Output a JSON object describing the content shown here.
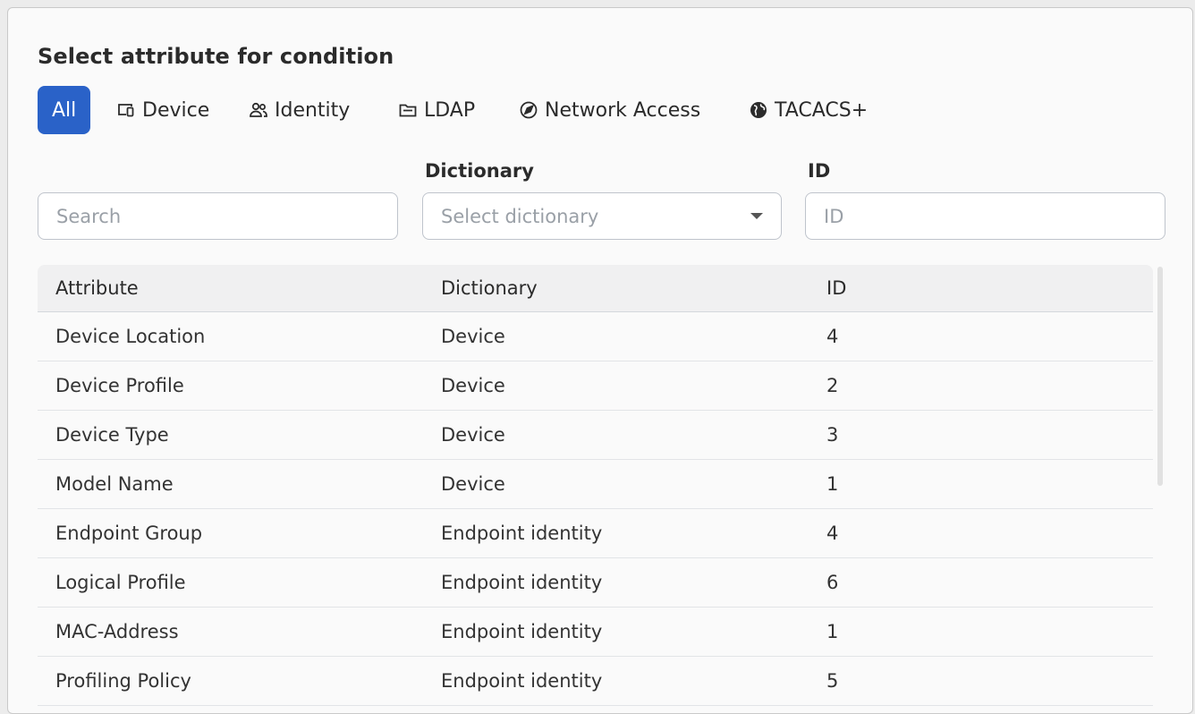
{
  "header": {
    "title": "Select attribute for condition"
  },
  "tabs": [
    {
      "label": "All",
      "icon": "",
      "active": true
    },
    {
      "label": "Device",
      "icon": "device-icon",
      "active": false
    },
    {
      "label": "Identity",
      "icon": "identity-icon",
      "active": false
    },
    {
      "label": "LDAP",
      "icon": "folder-icon",
      "active": false
    },
    {
      "label": "Network Access",
      "icon": "network-access-icon",
      "active": false
    },
    {
      "label": "TACACS+",
      "icon": "globe-icon",
      "active": false
    }
  ],
  "filters": {
    "search": {
      "label": "",
      "placeholder": "Search"
    },
    "dictionary": {
      "label": "Dictionary",
      "placeholder": "Select dictionary"
    },
    "id": {
      "label": "ID",
      "placeholder": "ID"
    }
  },
  "table": {
    "columns": [
      "Attribute",
      "Dictionary",
      "ID"
    ],
    "rows": [
      {
        "attribute": "Device Location",
        "dictionary": "Device",
        "id": "4"
      },
      {
        "attribute": "Device Profile",
        "dictionary": "Device",
        "id": "2"
      },
      {
        "attribute": "Device Type",
        "dictionary": "Device",
        "id": "3"
      },
      {
        "attribute": "Model Name",
        "dictionary": "Device",
        "id": "1"
      },
      {
        "attribute": "Endpoint Group",
        "dictionary": "Endpoint identity",
        "id": "4"
      },
      {
        "attribute": "Logical Profile",
        "dictionary": "Endpoint identity",
        "id": "6"
      },
      {
        "attribute": "MAC-Address",
        "dictionary": "Endpoint identity",
        "id": "1"
      },
      {
        "attribute": "Profiling Policy",
        "dictionary": "Endpoint identity",
        "id": "5"
      }
    ]
  },
  "colors": {
    "accent": "#2a62c8"
  }
}
